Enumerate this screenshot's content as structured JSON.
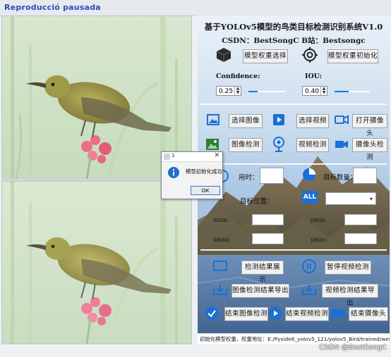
{
  "window": {
    "title": "Reproducció pausada"
  },
  "panel": {
    "heading": "基于YOLOv5模型的鸟类目标检测识别系统V1.0",
    "subheading": "CSDN：BestSongC   B站：Bestsongc",
    "buttons": {
      "select_weights": "模型权重选择",
      "init_weights": "模型权重初始化",
      "select_image": "选择图像",
      "select_video": "选择视频",
      "open_camera": "打开摄像头",
      "image_detect": "图像检测",
      "video_detect": "视频检测",
      "camera_detect": "摄像头检测",
      "show_result": "检测结果展示",
      "pause_video": "暂停视频检测",
      "export_image": "图像检测结果导出",
      "export_video": "视频检测结果导出",
      "end_image": "结束图像检测",
      "end_video": "结束视频检测",
      "end_camera": "结束摄像头"
    },
    "confidence": {
      "label": "Confidence:",
      "value": "0.25",
      "slider_fraction": 0.25
    },
    "iou": {
      "label": "IOU:",
      "value": "0.40",
      "slider_fraction": 0.4
    },
    "time_label": "用时：",
    "target_count_label": "目标数量：",
    "target_position_label": "目标位置：",
    "all_icon_text": "ALL",
    "coords": {
      "xmin": "xmin:",
      "ymin": "ymin:",
      "xmax": "xmax:",
      "ymax": "ymax:"
    }
  },
  "status_bar": {
    "text": "初始化模型权重，权重地址：E:/Pyside6_yolov5_121/yolov5_Bird/trained/weights/best.pt"
  },
  "dialog": {
    "title": "1",
    "message": "模型初始化成功",
    "ok_label": "OK"
  },
  "watermark": "CSDN @BestSongC",
  "colors": {
    "accent": "#1a73e8",
    "title_text": "#2a4fb6",
    "sky": "#9fc2e6",
    "mountain": "#7a6a4e"
  }
}
